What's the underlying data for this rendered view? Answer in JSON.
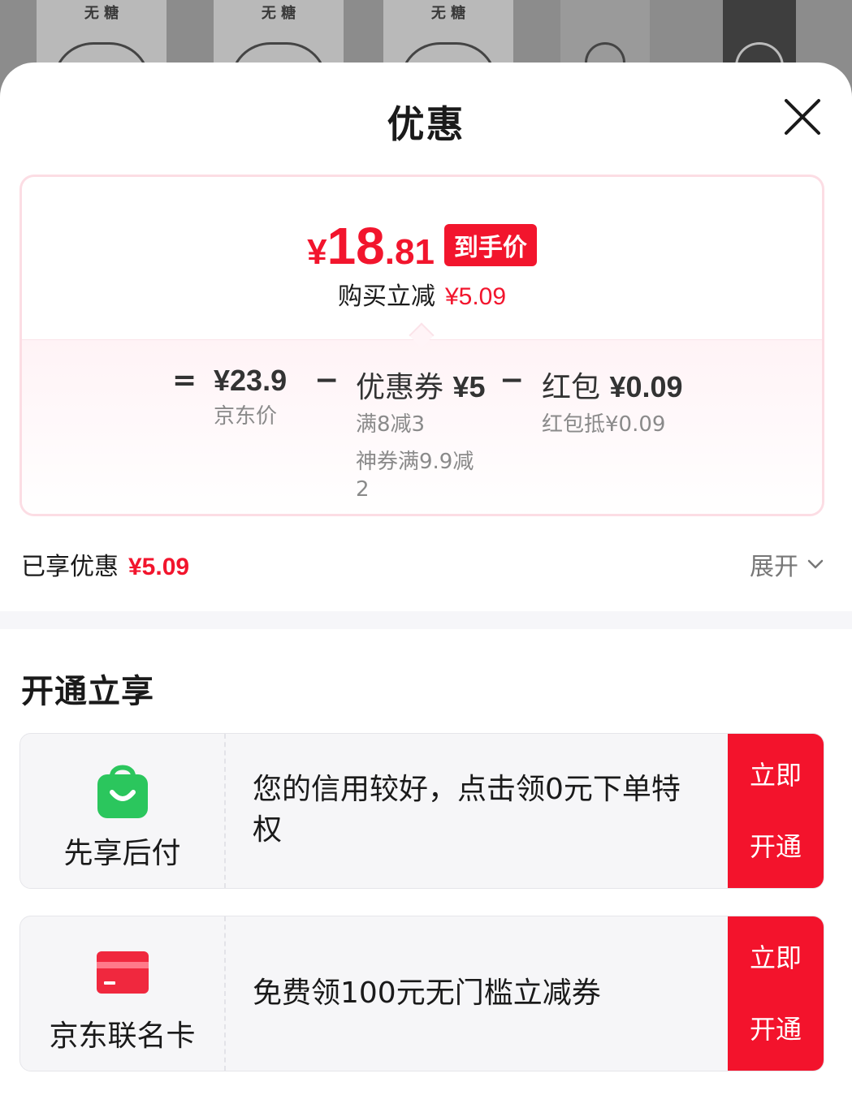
{
  "background": {
    "can_label": "无 糖"
  },
  "sheet": {
    "title": "优惠",
    "close_icon": "close-icon"
  },
  "price_card": {
    "final_price_yen": "¥",
    "final_price_int": "18",
    "final_price_dec": ".81",
    "final_badge": "到手价",
    "reduce_label": "购买立减",
    "reduce_amount": "¥5.09",
    "calc": {
      "equals": "=",
      "minus": "−",
      "jd_price": {
        "label": "",
        "value": "¥23.9",
        "sub": "京东价"
      },
      "coupon": {
        "label": "优惠券",
        "value": "¥5",
        "sub1": "满8减3",
        "sub2": "神券满9.9减",
        "sub3": "2"
      },
      "redpack": {
        "label": "红包",
        "value": "¥0.09",
        "sub": "红包抵¥0.09"
      }
    }
  },
  "enjoyed": {
    "label": "已享优惠",
    "amount": "¥5.09",
    "expand_label": "展开"
  },
  "open_section": {
    "title": "开通立享",
    "offers": [
      {
        "name": "先享后付",
        "icon": "shopping-bag-icon",
        "description_line1": "您的信用较好，点击领0元下单特",
        "description_line2": "权",
        "cta_line1": "立即",
        "cta_line2": "开通"
      },
      {
        "name": "京东联名卡",
        "icon": "credit-card-icon",
        "description_line1": "免费领100元无门槛立减券",
        "cta_line1": "立即",
        "cta_line2": "开通"
      }
    ]
  },
  "colors": {
    "accent_red": "#f2152d",
    "green_icon": "#2bc65d",
    "card_border": "#fcdde4"
  }
}
